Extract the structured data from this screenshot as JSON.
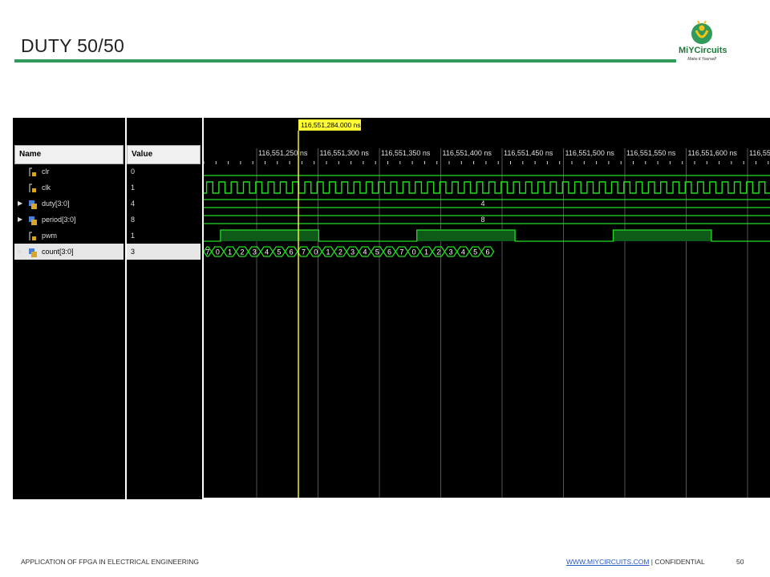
{
  "slide": {
    "title": "DUTY 50/50"
  },
  "logo": {
    "name": "MiYCircuits",
    "tagline": "Make it Yourself"
  },
  "footer": {
    "left": "APPLICATION OF FPGA IN ELECTRICAL ENGINEERING",
    "link": "WWW.MIYCIRCUITS.COM",
    "separator": " | ",
    "confidential": "CONFIDENTIAL",
    "page": "50"
  },
  "simulator": {
    "name_header": "Name",
    "value_header": "Value",
    "cursor_time": "116,551,284.000 ns",
    "time_ticks": [
      "116,551,250 ns",
      "116,551,300 ns",
      "116,551,350 ns",
      "116,551,400 ns",
      "116,551,450 ns",
      "116,551,500 ns",
      "116,551,550 ns",
      "116,551,600 ns",
      "116,55"
    ],
    "signals": [
      {
        "name": "clr",
        "value": "0",
        "bus": false,
        "expandable": false,
        "selected": false
      },
      {
        "name": "clk",
        "value": "1",
        "bus": false,
        "expandable": false,
        "selected": false
      },
      {
        "name": "duty[3:0]",
        "value": "4",
        "bus": true,
        "expandable": true,
        "selected": false
      },
      {
        "name": "period[3:0]",
        "value": "8",
        "bus": true,
        "expandable": true,
        "selected": false
      },
      {
        "name": "pwm",
        "value": "1",
        "bus": false,
        "expandable": false,
        "selected": false
      },
      {
        "name": "count[3:0]",
        "value": "3",
        "bus": true,
        "expandable": true,
        "selected": true
      }
    ],
    "bus_labels": {
      "duty": "4",
      "period": "8"
    },
    "count_sequence": [
      "7",
      "0",
      "1",
      "2",
      "3",
      "4",
      "5",
      "6",
      "7",
      "0",
      "1",
      "2",
      "3",
      "4",
      "5",
      "6",
      "7",
      "0",
      "1",
      "2",
      "3",
      "4",
      "5",
      "6"
    ],
    "colors": {
      "wave": "#22dd22",
      "grid": "#555555",
      "cursor": "#ffff33",
      "cursor_label_bg": "#ffff33"
    }
  }
}
